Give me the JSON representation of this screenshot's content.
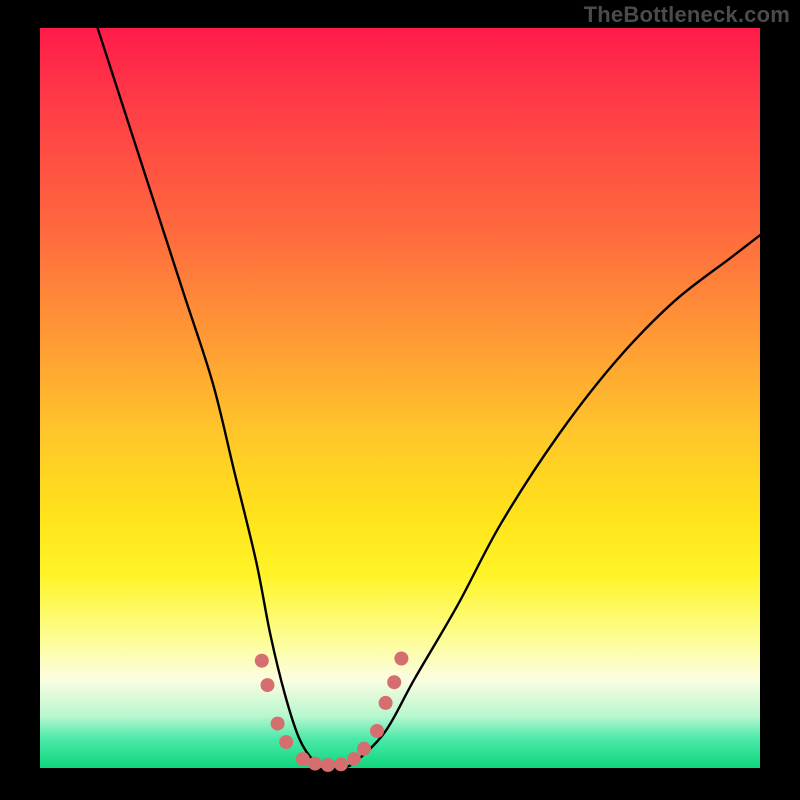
{
  "watermark": "TheBottleneck.com",
  "chart_data": {
    "type": "line",
    "title": "",
    "xlabel": "",
    "ylabel": "",
    "xlim": [
      0,
      100
    ],
    "ylim": [
      0,
      100
    ],
    "series": [
      {
        "name": "bottleneck-curve",
        "x": [
          8,
          12,
          16,
          20,
          24,
          27,
          30,
          32,
          34,
          36,
          38,
          40,
          42,
          44,
          48,
          52,
          58,
          64,
          72,
          80,
          88,
          96,
          100
        ],
        "y": [
          100,
          88,
          76,
          64,
          52,
          40,
          28,
          18,
          10,
          4,
          1,
          0,
          0,
          1,
          5,
          12,
          22,
          33,
          45,
          55,
          63,
          69,
          72
        ]
      }
    ],
    "annotations": [
      {
        "name": "valley-speckle",
        "color": "#d56e6e",
        "points": [
          [
            30.8,
            14.5
          ],
          [
            31.6,
            11.2
          ],
          [
            33.0,
            6.0
          ],
          [
            34.2,
            3.5
          ],
          [
            36.5,
            1.2
          ],
          [
            38.2,
            0.6
          ],
          [
            40.0,
            0.4
          ],
          [
            41.8,
            0.5
          ],
          [
            43.6,
            1.2
          ],
          [
            45.0,
            2.6
          ],
          [
            46.8,
            5.0
          ],
          [
            48.0,
            8.8
          ],
          [
            49.2,
            11.6
          ],
          [
            50.2,
            14.8
          ]
        ]
      }
    ],
    "gradient_stops": [
      {
        "pos": 0,
        "color": "#ff1b4a"
      },
      {
        "pos": 28,
        "color": "#ff6b3e"
      },
      {
        "pos": 55,
        "color": "#ffc72a"
      },
      {
        "pos": 74,
        "color": "#fff428"
      },
      {
        "pos": 88,
        "color": "#fcfde0"
      },
      {
        "pos": 100,
        "color": "#0ed77d"
      }
    ]
  }
}
